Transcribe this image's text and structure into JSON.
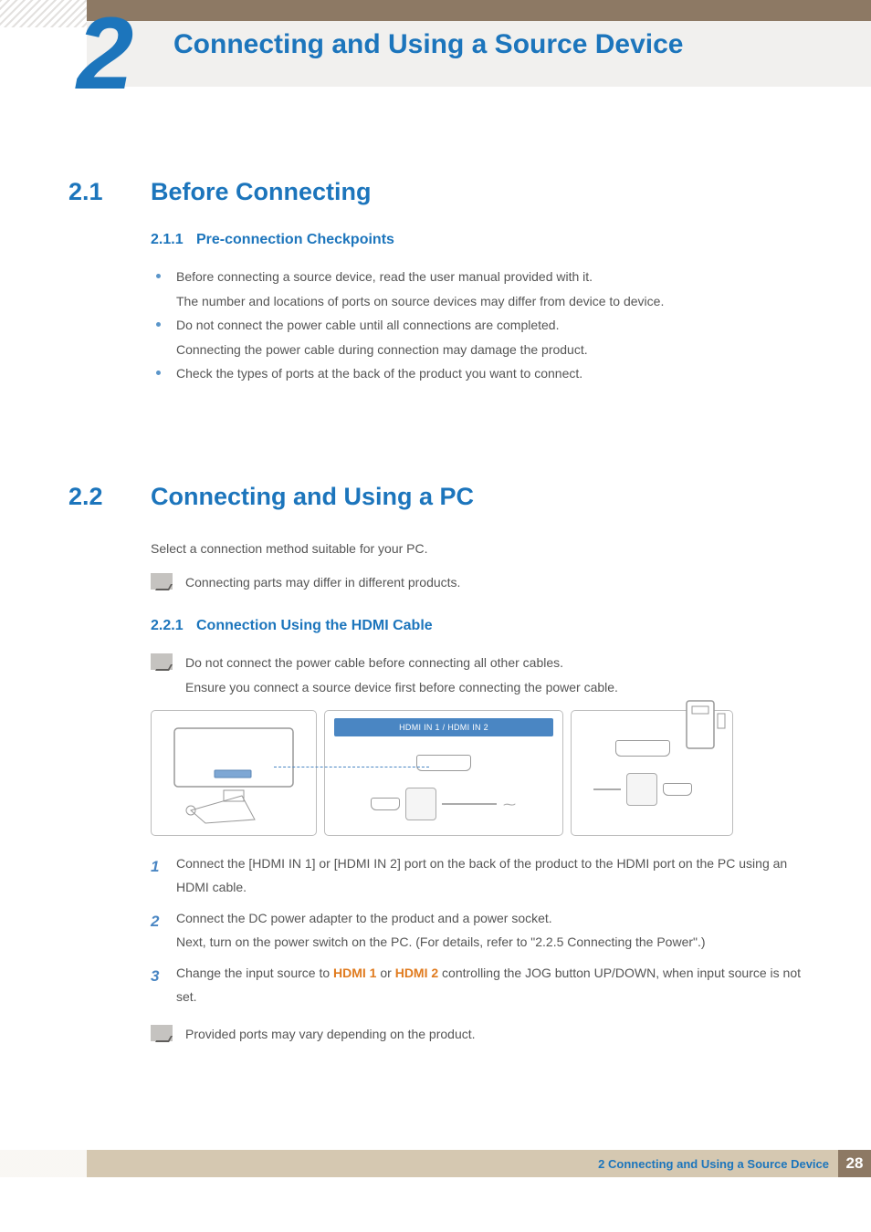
{
  "chapter": {
    "number": "2",
    "title": "Connecting and Using a Source Device"
  },
  "s21": {
    "num": "2.1",
    "title": "Before Connecting",
    "s211": {
      "num": "2.1.1",
      "title": "Pre-connection Checkpoints",
      "bullets": [
        "Before connecting a source device, read the user manual provided with it.\nThe number and locations of ports on source devices may differ from device to device.",
        "Do not connect the power cable until all connections are completed.\nConnecting the power cable during connection may damage the product.",
        "Check the types of ports at the back of the product you want to connect."
      ]
    }
  },
  "s22": {
    "num": "2.2",
    "title": "Connecting and Using a PC",
    "intro": "Select a connection method suitable for your PC.",
    "note1": "Connecting parts may differ in different products.",
    "s221": {
      "num": "2.2.1",
      "title": "Connection Using the HDMI Cable",
      "warn_a": "Do not connect the power cable before connecting all other cables.",
      "warn_b": "Ensure you connect a source device first before connecting the power cable.",
      "port_label": "HDMI IN 1 / HDMI IN 2",
      "steps": {
        "n1": "1",
        "t1": "Connect the [HDMI IN 1] or [HDMI IN 2] port on the back of the product to the HDMI port on the PC using an HDMI cable.",
        "n2": "2",
        "t2": "Connect the DC power adapter to the product and a power socket.\nNext, turn on the power switch on the PC. (For details, refer to \"2.2.5     Connecting the Power\".)",
        "n3": "3",
        "t3a": "Change the input source to ",
        "hdmi1": "HDMI 1",
        "or": " or ",
        "hdmi2": "HDMI 2",
        "t3b": " controlling the JOG button UP/DOWN, when input source is not set."
      },
      "note2": "Provided ports may vary depending on the product."
    }
  },
  "footer": {
    "title": "2 Connecting and Using a Source Device",
    "page": "28"
  }
}
